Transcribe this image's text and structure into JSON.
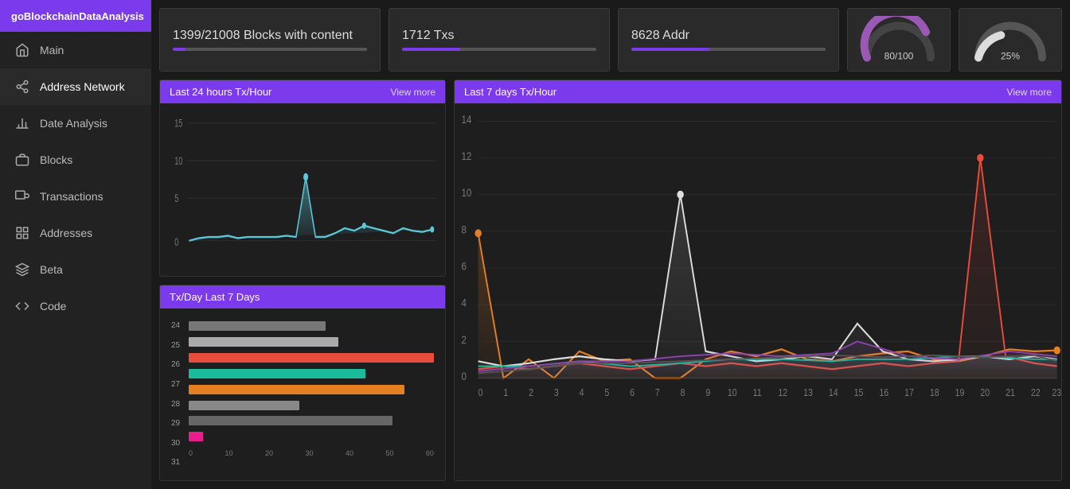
{
  "app": {
    "title": "goBlockchainDataAnalysis"
  },
  "sidebar": {
    "items": [
      {
        "id": "main",
        "label": "Main",
        "icon": "home"
      },
      {
        "id": "address-network",
        "label": "Address Network",
        "icon": "network",
        "active": true
      },
      {
        "id": "date-analysis",
        "label": "Date Analysis",
        "icon": "chart"
      },
      {
        "id": "blocks",
        "label": "Blocks",
        "icon": "blocks"
      },
      {
        "id": "transactions",
        "label": "Transactions",
        "icon": "transactions"
      },
      {
        "id": "addresses",
        "label": "Addresses",
        "icon": "grid"
      },
      {
        "id": "beta",
        "label": "Beta",
        "icon": "beta"
      },
      {
        "id": "code",
        "label": "Code",
        "icon": "code"
      }
    ]
  },
  "stats": {
    "blocks": {
      "label": "1399/21008 Blocks with content",
      "bar_pct": 6.7
    },
    "txs": {
      "label": "1712 Txs",
      "bar_pct": 30
    },
    "addr": {
      "label": "8628 Addr",
      "bar_pct": 40
    },
    "gauge1": {
      "label": "80/100",
      "pct": 80,
      "color": "#9b59b6"
    },
    "gauge2": {
      "label": "25%",
      "pct": 25,
      "color": "#ccc"
    }
  },
  "charts": {
    "tx_hour": {
      "title": "Last 24 hours Tx/Hour",
      "view_more": "View more"
    },
    "tx_day": {
      "title": "Tx/Day Last 7 Days",
      "view_more": "",
      "rows": [
        {
          "day": "24",
          "value": 35,
          "color": "#777"
        },
        {
          "day": "25",
          "value": 38,
          "color": "#aaa"
        },
        {
          "day": "26",
          "value": 62,
          "color": "#e74c3c"
        },
        {
          "day": "27",
          "value": 45,
          "color": "#1abc9c"
        },
        {
          "day": "28",
          "value": 55,
          "color": "#e67e22"
        },
        {
          "day": "29",
          "value": 28,
          "color": "#888"
        },
        {
          "day": "30",
          "value": 52,
          "color": "#777"
        },
        {
          "day": "31",
          "value": 4,
          "color": "#e91e8c"
        }
      ],
      "axis": [
        "0",
        "10",
        "20",
        "30",
        "40",
        "50",
        "60"
      ]
    },
    "tx_7days": {
      "title": "Last 7 days Tx/Hour",
      "view_more": "View more"
    }
  }
}
